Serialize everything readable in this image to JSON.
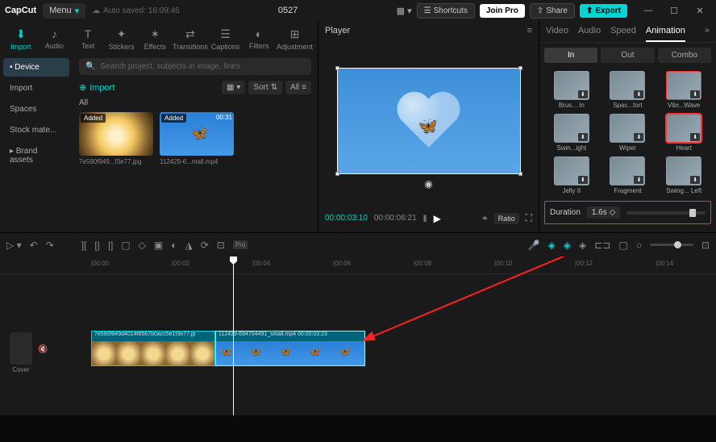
{
  "titlebar": {
    "app": "CapCut",
    "menu": "Menu",
    "autosave": "Auto saved: 16:09:46",
    "project": "0527",
    "shortcuts": "Shortcuts",
    "joinpro": "Join Pro",
    "share": "Share",
    "export": "Export"
  },
  "tabs": [
    "Import",
    "Audio",
    "Text",
    "Stickers",
    "Effects",
    "Transitions",
    "Captions",
    "Filters",
    "Adjustment"
  ],
  "sidebar": {
    "items": [
      "Device",
      "Import",
      "Spaces",
      "Stock mate...",
      "Brand assets"
    ]
  },
  "importPanel": {
    "searchPlaceholder": "Search project, subjects in image, lines",
    "importBtn": "Import",
    "sort": "Sort",
    "all": "All",
    "allLabel": "All",
    "media": [
      {
        "badge": "Added",
        "dur": "",
        "name": "7e590f949...f3e77.jpg"
      },
      {
        "badge": "Added",
        "dur": "00:31",
        "name": "112429-6...mall.mp4"
      }
    ]
  },
  "player": {
    "title": "Player",
    "current": "00:00:03:10",
    "total": "00:00:06:21",
    "ratio": "Ratio"
  },
  "rightPanel": {
    "tabs": [
      "Video",
      "Audio",
      "Speed",
      "Animation"
    ],
    "subtabs": [
      "In",
      "Out",
      "Combo"
    ],
    "animations": [
      {
        "name": "Brus... In"
      },
      {
        "name": "Spac...tort"
      },
      {
        "name": "Vibr...Wave"
      },
      {
        "name": "Swin...ight"
      },
      {
        "name": "Wiper"
      },
      {
        "name": "Heart"
      },
      {
        "name": "Jelly II"
      },
      {
        "name": "Fragment"
      },
      {
        "name": "Swing... Left"
      }
    ],
    "duration": {
      "label": "Duration",
      "value": "1.6s"
    }
  },
  "timeline": {
    "ticks": [
      "00:00",
      "00:02",
      "00:04",
      "00:06",
      "00:08",
      "00:10",
      "00:12",
      "00:14"
    ],
    "cover": "Cover",
    "clips": [
      {
        "header": "7e590f949d4014f6567b0acc5e1f3e77.jp"
      },
      {
        "header": "112429-694704491_small.mp4  00:00:03:23"
      }
    ]
  }
}
